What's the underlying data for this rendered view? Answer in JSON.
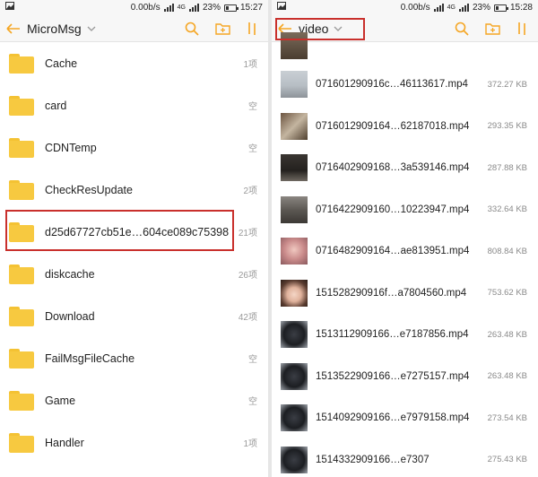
{
  "left": {
    "status": {
      "speed": "0.00b/s",
      "network": "4G",
      "battery": "23%",
      "time": "15:27"
    },
    "title": "MicroMsg",
    "folders": [
      {
        "name": "Cache",
        "count": "1项"
      },
      {
        "name": "card",
        "count": "空"
      },
      {
        "name": "CDNTemp",
        "count": "空"
      },
      {
        "name": "CheckResUpdate",
        "count": "2项"
      },
      {
        "name": "d25d67727cb51e…604ce089c75398",
        "count": "21项"
      },
      {
        "name": "diskcache",
        "count": "26项"
      },
      {
        "name": "Download",
        "count": "42项"
      },
      {
        "name": "FailMsgFileCache",
        "count": "空"
      },
      {
        "name": "Game",
        "count": "空"
      },
      {
        "name": "Handler",
        "count": "1项"
      }
    ]
  },
  "right": {
    "status": {
      "speed": "0.00b/s",
      "network": "4G",
      "battery": "23%",
      "time": "15:28"
    },
    "title": "video",
    "files": [
      {
        "name": "071601290916c…46113617.mp4",
        "size": "372.27 KB",
        "thumb": "snow"
      },
      {
        "name": "0716012909164…62187018.mp4",
        "size": "293.35 KB",
        "thumb": "room"
      },
      {
        "name": "0716402909168…3a539146.mp4",
        "size": "287.88 KB",
        "thumb": "dark"
      },
      {
        "name": "0716422909160…10223947.mp4",
        "size": "332.64 KB",
        "thumb": "street"
      },
      {
        "name": "0716482909164…ae813951.mp4",
        "size": "808.84 KB",
        "thumb": "pink"
      },
      {
        "name": "151528290916f…a7804560.mp4",
        "size": "753.62 KB",
        "thumb": "face"
      },
      {
        "name": "1513112909166…e7187856.mp4",
        "size": "263.48 KB",
        "thumb": "cat"
      },
      {
        "name": "1513522909166…e7275157.mp4",
        "size": "263.48 KB",
        "thumb": "cat"
      },
      {
        "name": "1514092909166…e7979158.mp4",
        "size": "273.54 KB",
        "thumb": "cat"
      },
      {
        "name": "1514332909166…e7307",
        "size": "275.43 KB",
        "thumb": "cat"
      }
    ]
  },
  "colors": {
    "accent": "#f5a623",
    "highlight": "#c9302c",
    "folder": "#f7c940"
  }
}
